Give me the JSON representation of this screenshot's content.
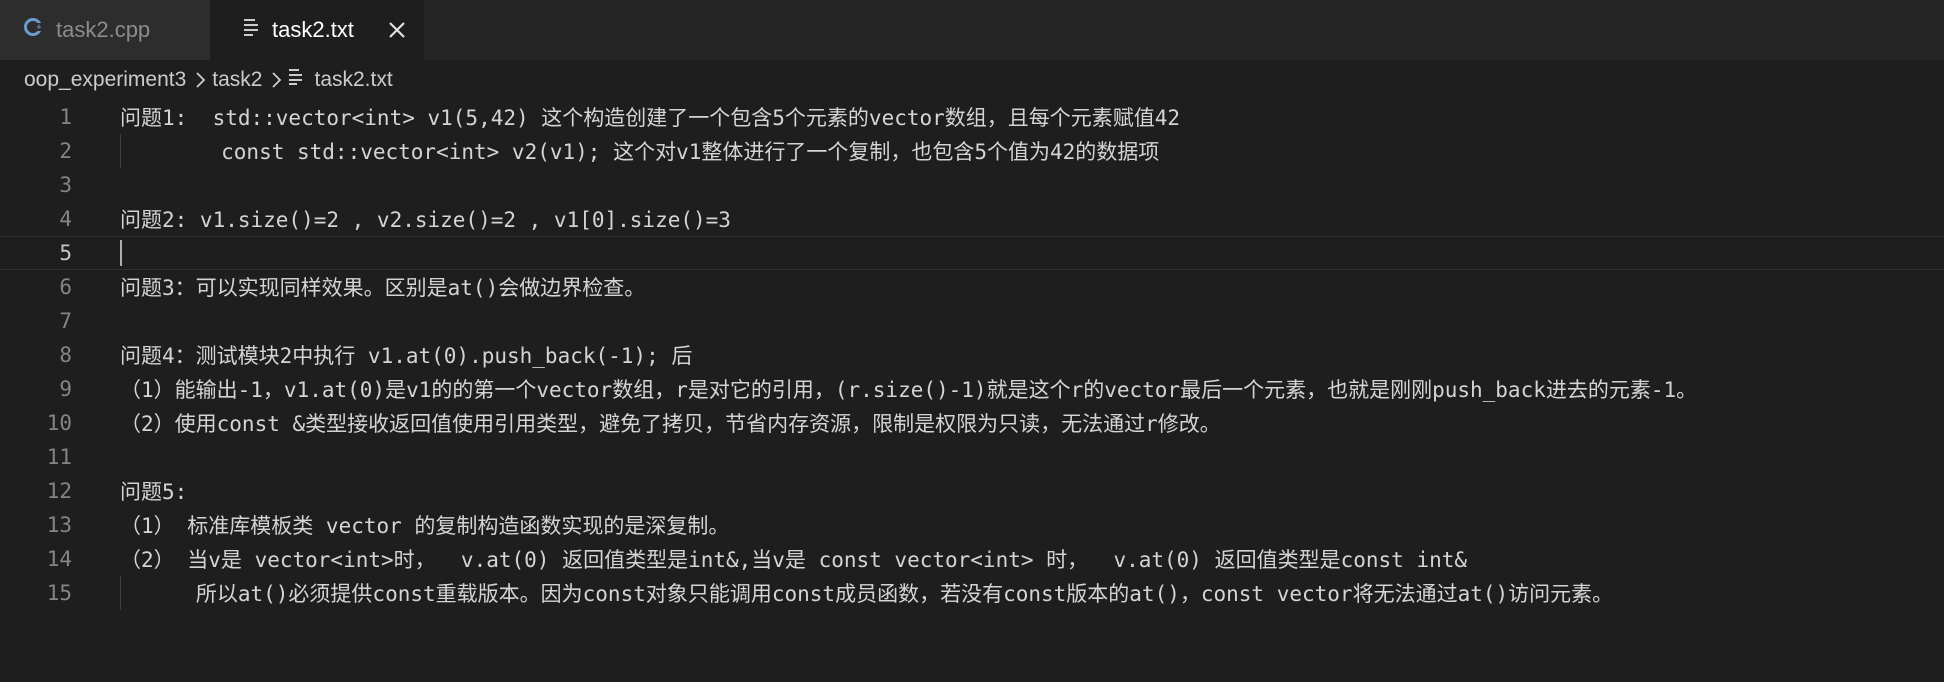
{
  "tabs": [
    {
      "label": "task2.cpp",
      "icon": "cpp-file-icon",
      "active": false
    },
    {
      "label": "task2.txt",
      "icon": "text-file-icon",
      "active": true
    }
  ],
  "breadcrumb": {
    "folder": "oop_experiment3",
    "subfolder": "task2",
    "file": "task2.txt"
  },
  "editor": {
    "current_line": 5,
    "lines": [
      {
        "num": "1",
        "text": "问题1:  std::vector<int> v1(5,42) 这个构造创建了一个包含5个元素的vector数组，且每个元素赋值42"
      },
      {
        "num": "2",
        "text": "        const std::vector<int> v2(v1); 这个对v1整体进行了一个复制，也包含5个值为42的数据项"
      },
      {
        "num": "3",
        "text": ""
      },
      {
        "num": "4",
        "text": "问题2: v1.size()=2 , v2.size()=2 , v1[0].size()=3"
      },
      {
        "num": "5",
        "text": ""
      },
      {
        "num": "6",
        "text": "问题3：可以实现同样效果。区别是at()会做边界检查。"
      },
      {
        "num": "7",
        "text": ""
      },
      {
        "num": "8",
        "text": "问题4：测试模块2中执行 v1.at(0).push_back(-1); 后"
      },
      {
        "num": "9",
        "text": "（1）能输出-1，v1.at(0)是v1的的第一个vector数组，r是对它的引用，(r.size()-1)就是这个r的vector最后一个元素，也就是刚刚push_back进去的元素-1。"
      },
      {
        "num": "10",
        "text": "（2）使用const &类型接收返回值使用引用类型，避免了拷贝，节省内存资源，限制是权限为只读，无法通过r修改。"
      },
      {
        "num": "11",
        "text": ""
      },
      {
        "num": "12",
        "text": "问题5:"
      },
      {
        "num": "13",
        "text": "（1） 标准库模板类 vector 的复制构造函数实现的是深复制。"
      },
      {
        "num": "14",
        "text": "（2） 当v是 vector<int>时，  v.at(0) 返回值类型是int&,当v是 const vector<int> 时，  v.at(0) 返回值类型是const int&"
      },
      {
        "num": "15",
        "text": "      所以at()必须提供const重载版本。因为const对象只能调用const成员函数，若没有const版本的at()，const vector将无法通过at()访问元素。"
      }
    ]
  },
  "colors": {
    "background": "#1e1e1e",
    "tabbar": "#252526",
    "inactive_tab": "#2d2d2d",
    "text": "#d4d4d4",
    "line_number": "#858585",
    "cpp_icon": "#6c9bd2"
  }
}
